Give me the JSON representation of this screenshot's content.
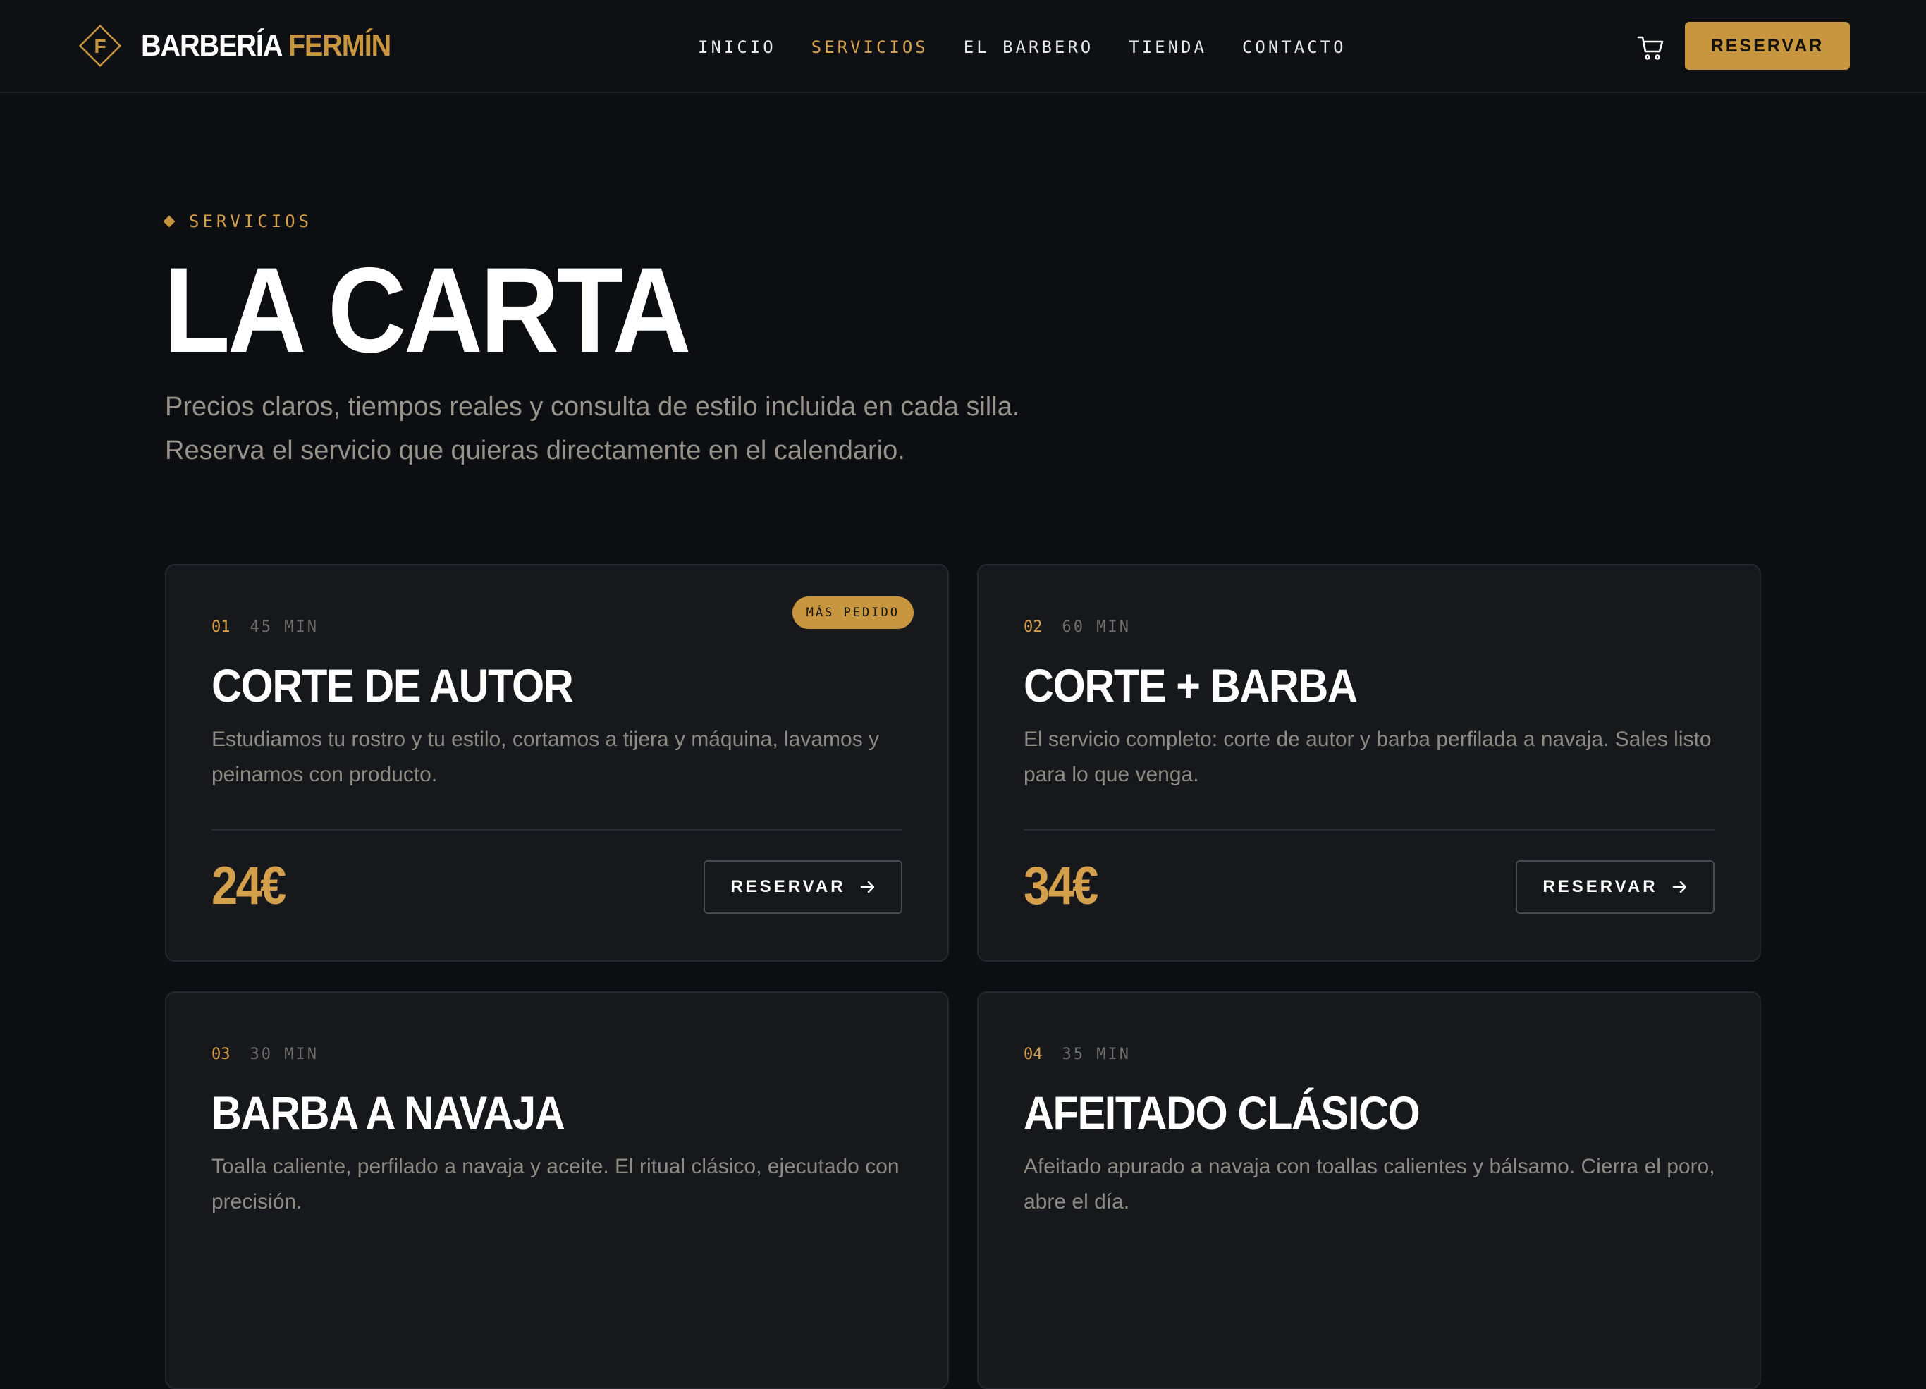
{
  "brand": {
    "mark": "F",
    "name_white": "BARBERÍA",
    "name_gold": "FERMÍN"
  },
  "nav": {
    "items": [
      {
        "label": "INICIO"
      },
      {
        "label": "SERVICIOS"
      },
      {
        "label": "EL BARBERO"
      },
      {
        "label": "TIENDA"
      },
      {
        "label": "CONTACTO"
      }
    ],
    "active": "SERVICIOS"
  },
  "header": {
    "cart_icon": "cart-icon",
    "reserve_label": "RESERVAR"
  },
  "hero": {
    "eyebrow": "SERVICIOS",
    "title": "LA CARTA",
    "subtitle_line1": "Precios claros, tiempos reales y consulta de estilo incluida en cada silla.",
    "subtitle_line2": "Reserva el servicio que quieras directamente en el calendario."
  },
  "services": [
    {
      "num": "01",
      "duration": "45 MIN",
      "badge": "MÁS PEDIDO",
      "title": "CORTE DE AUTOR",
      "desc": "Estudiamos tu rostro y tu estilo, cortamos a tijera y máquina, lavamos y peinamos con producto.",
      "price": "24€",
      "button": "RESERVAR"
    },
    {
      "num": "02",
      "duration": "60 MIN",
      "title": "CORTE + BARBA",
      "desc": "El servicio completo: corte de autor y barba perfilada a navaja. Sales listo para lo que venga.",
      "price": "34€",
      "button": "RESERVAR"
    },
    {
      "num": "03",
      "duration": "30 MIN",
      "title": "BARBA A NAVAJA",
      "desc": "Toalla caliente, perfilado a navaja y aceite. El ritual clásico, ejecutado con precisión."
    },
    {
      "num": "04",
      "duration": "35 MIN",
      "title": "AFEITADO CLÁSICO",
      "desc": "Afeitado apurado a navaja con toallas calientes y bálsamo. Cierra el poro, abre el día."
    }
  ],
  "colors": {
    "background": "#0d0e11",
    "accent": "#c8963f",
    "card": "#17181c",
    "muted_text": "#8e8a84"
  }
}
